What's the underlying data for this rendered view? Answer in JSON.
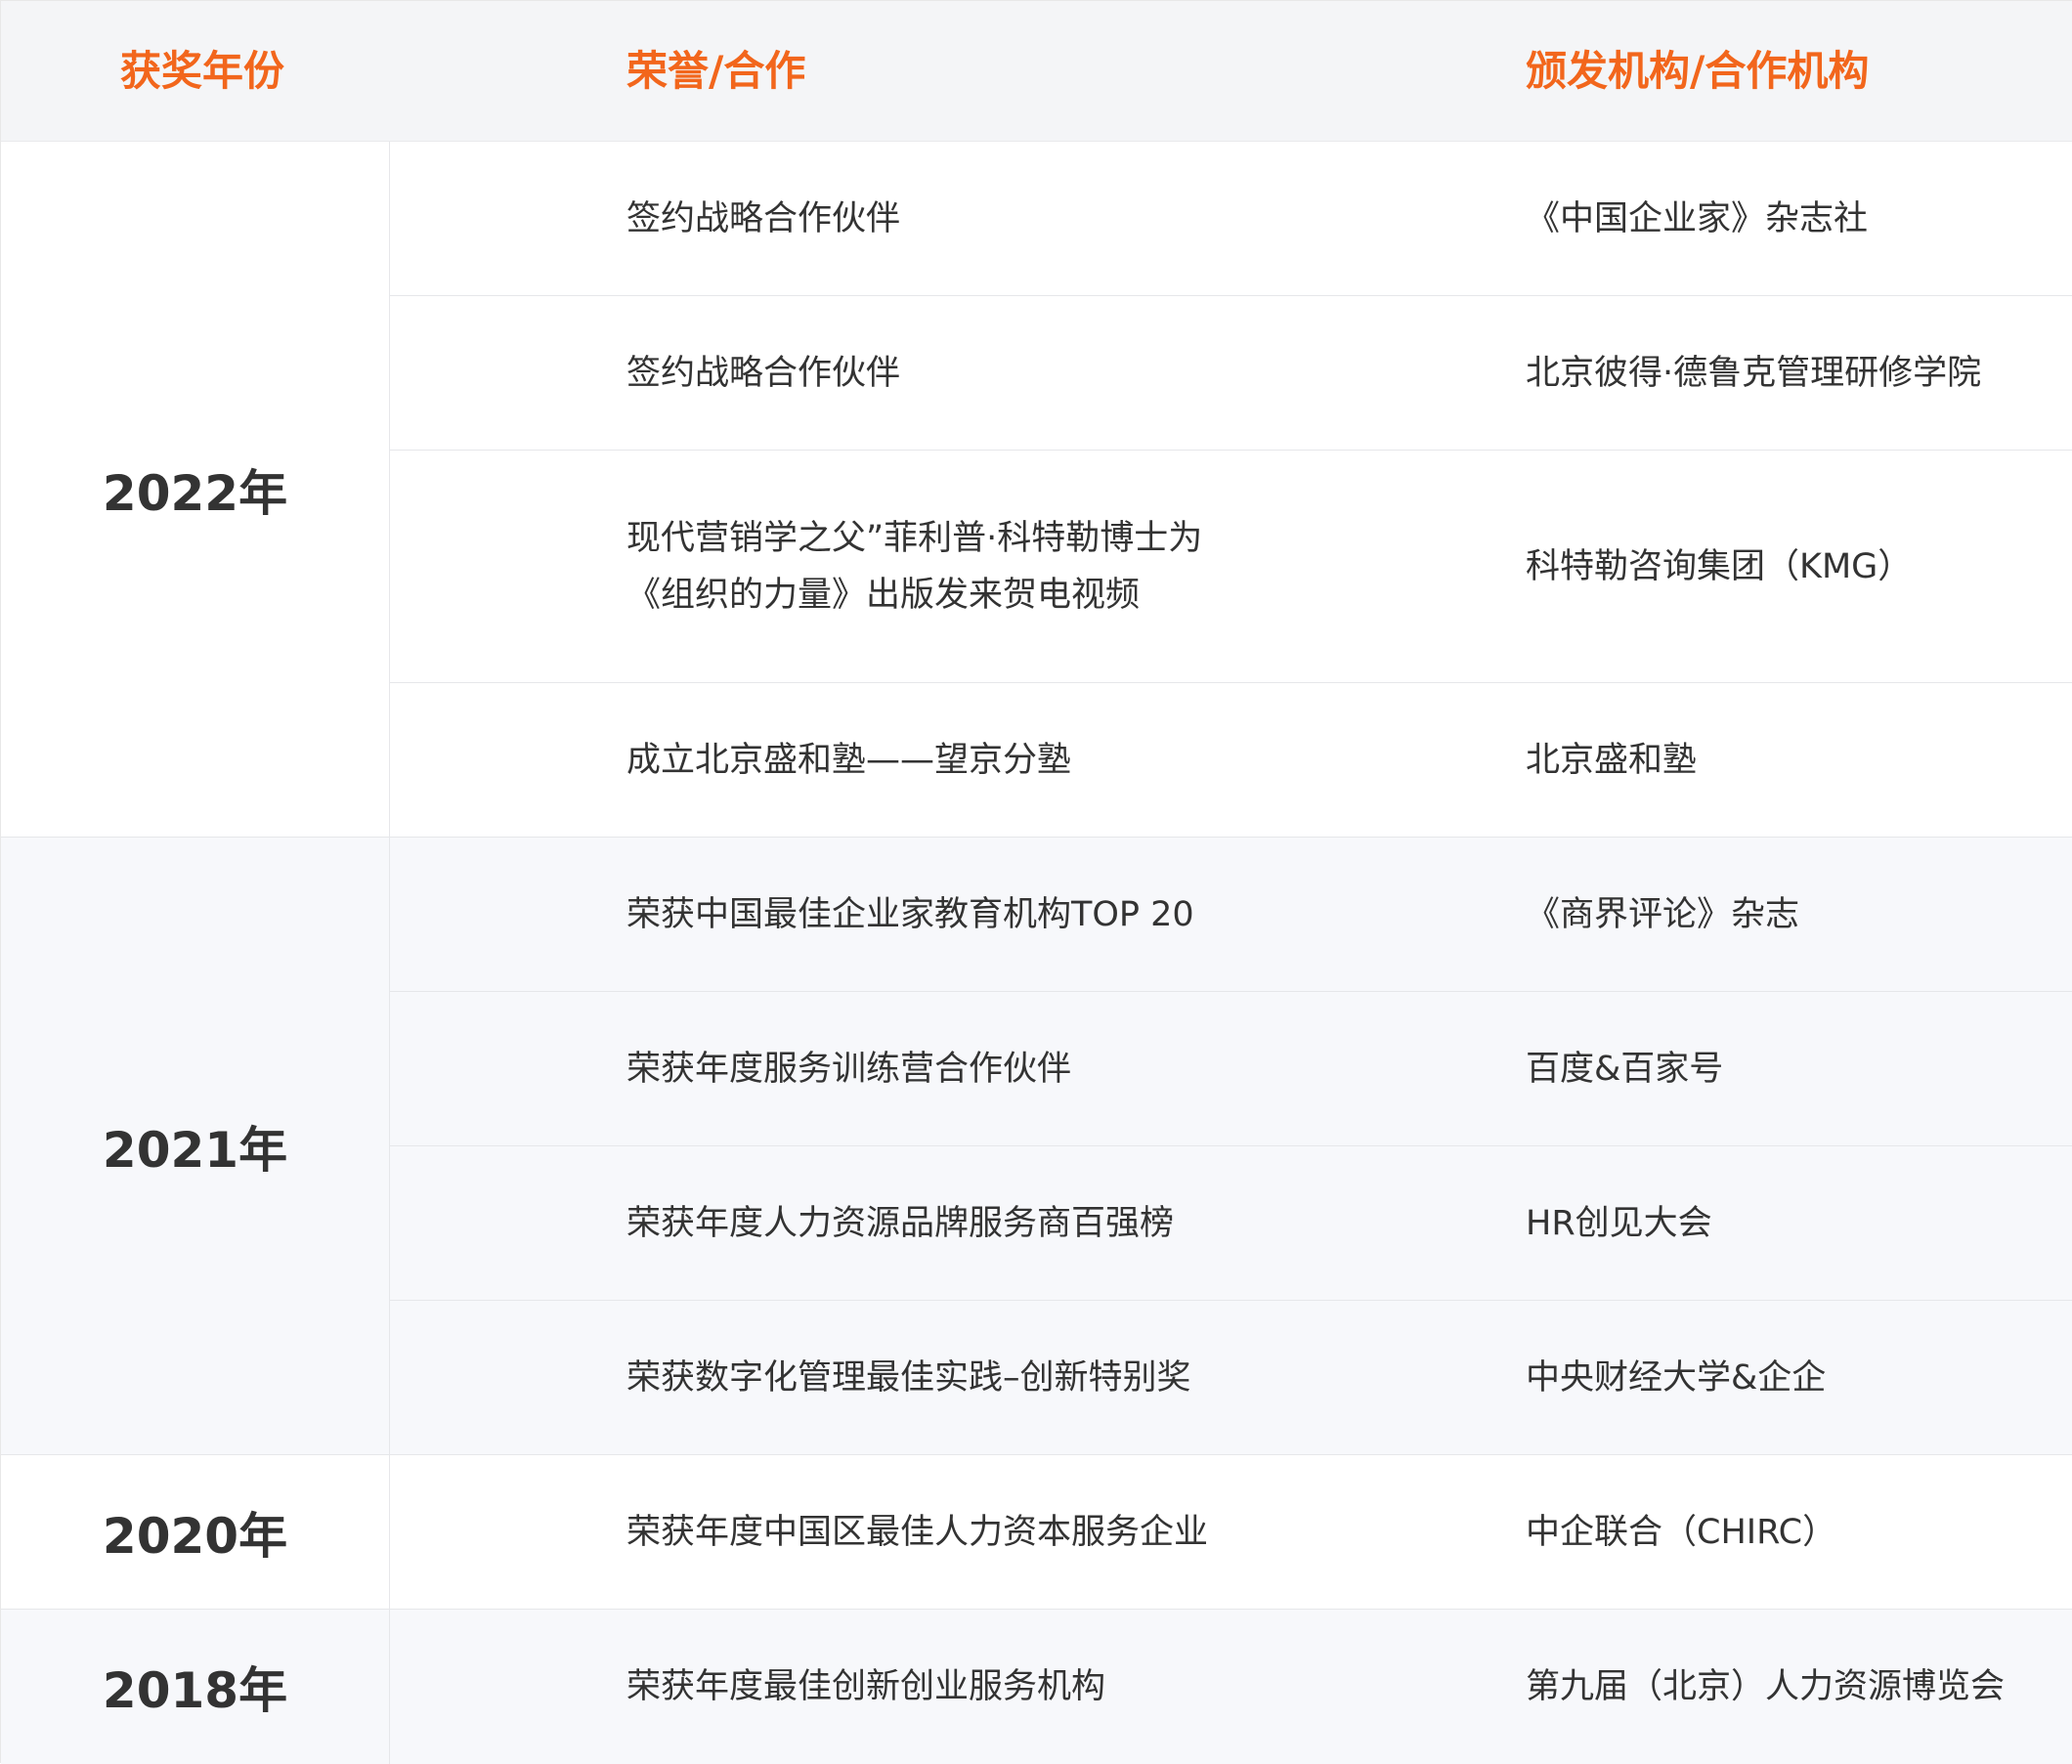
{
  "header": {
    "year_col": "获奖年份",
    "honor_col": "荣誉/合作",
    "org_col": "颁发机构/合作机构"
  },
  "groups": [
    {
      "year": "2022年",
      "rows": [
        {
          "honor": "签约战略合作伙伴",
          "org": "《中国企业家》杂志社"
        },
        {
          "honor": "签约战略合作伙伴",
          "org": "北京彼得·德鲁克管理研修学院"
        },
        {
          "honor": "现代营销学之父”菲利普·科特勒博士为《组织的力量》出版发来贺电视频",
          "org": "科特勒咨询集团（KMG）"
        },
        {
          "honor": "成立北京盛和塾——望京分塾",
          "org": "北京盛和塾"
        }
      ]
    },
    {
      "year": "2021年",
      "rows": [
        {
          "honor": "荣获中国最佳企业家教育机构TOP 20",
          "org": "《商界评论》杂志"
        },
        {
          "honor": "荣获年度服务训练营合作伙伴",
          "org": "百度&百家号"
        },
        {
          "honor": "荣获年度人力资源品牌服务商百强榜",
          "org": "HR创见大会"
        },
        {
          "honor": "荣获数字化管理最佳实践–创新特别奖",
          "org": "中央财经大学&企企"
        }
      ]
    },
    {
      "year": "2020年",
      "rows": [
        {
          "honor": "荣获年度中国区最佳人力资本服务企业",
          "org": "中企联合（CHIRC）"
        }
      ]
    },
    {
      "year": "2018年",
      "rows": [
        {
          "honor": "荣获年度最佳创新创业服务机构",
          "org": "第九届（北京）人力资源博览会"
        }
      ]
    }
  ]
}
